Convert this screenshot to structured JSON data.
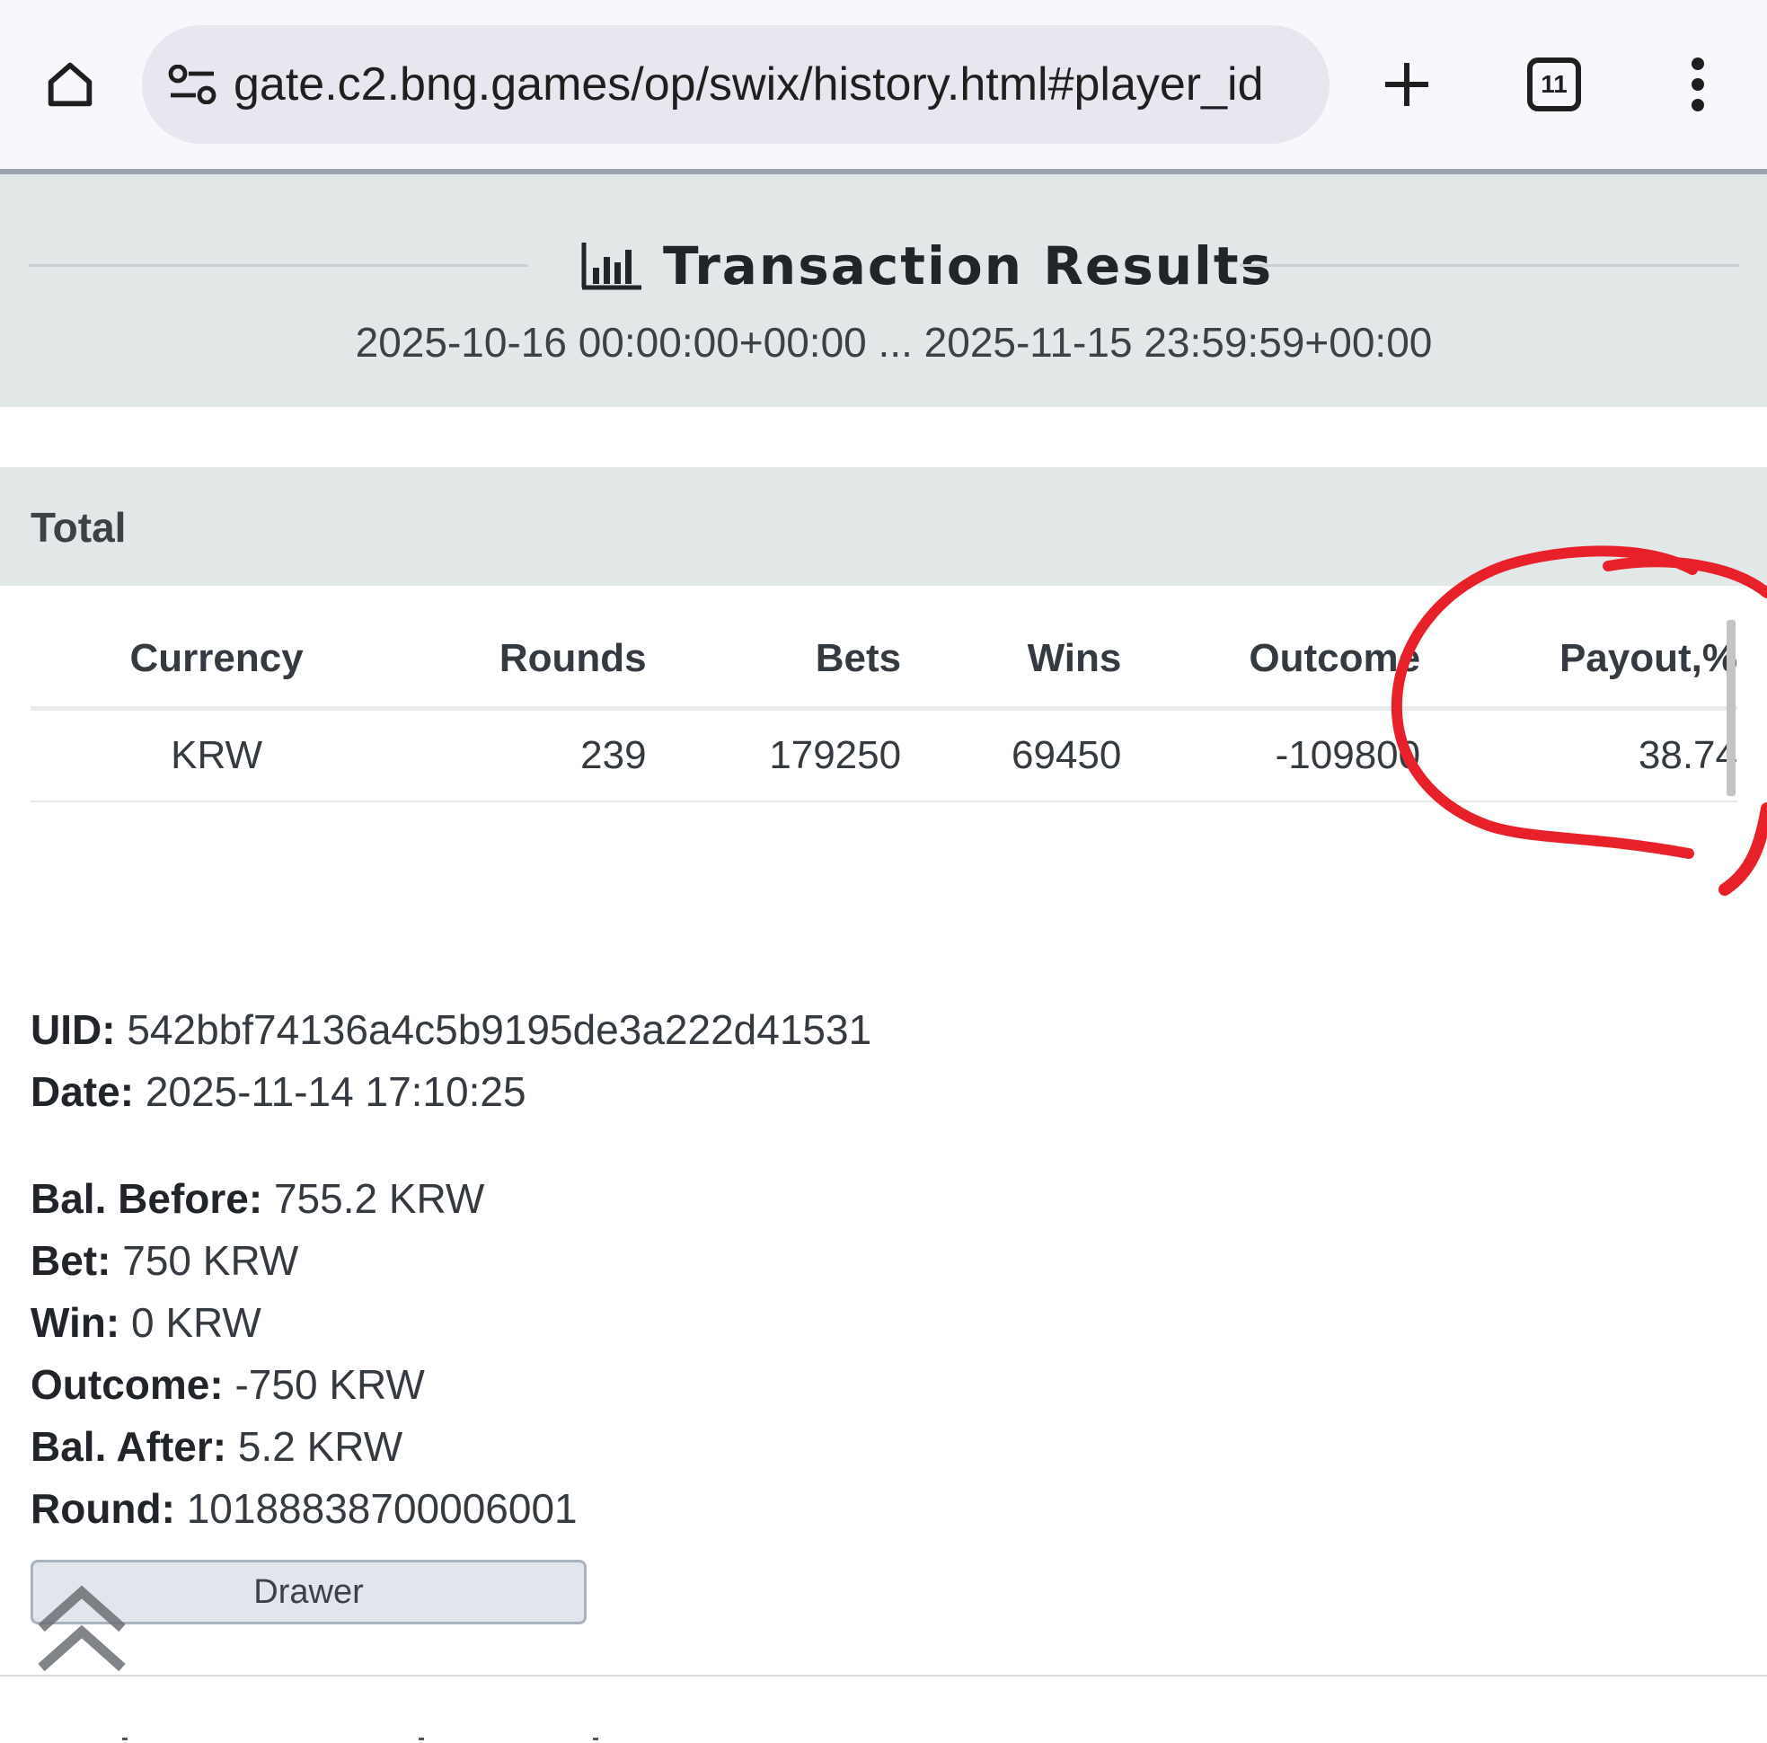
{
  "browser": {
    "url": "gate.c2.bng.games/op/swix/history.html#player_id",
    "tab_count": "11",
    "icons": {
      "home": "home-icon",
      "site_settings": "tune-icon",
      "new_tab": "plus-icon",
      "tabs": "tab-switcher-icon",
      "menu": "more-vert-icon"
    }
  },
  "header": {
    "icon": "bar-chart-icon",
    "title": "Transaction Results",
    "date_range": "2025-10-16 00:00:00+00:00 ... 2025-11-15 23:59:59+00:00"
  },
  "total": {
    "heading": "Total",
    "columns": [
      "Currency",
      "Rounds",
      "Bets",
      "Wins",
      "Outcome",
      "Payout,%"
    ],
    "rows": [
      [
        "KRW",
        "239",
        "179250",
        "69450",
        "-109800",
        "38.74"
      ]
    ]
  },
  "transaction": {
    "uid_label": "UID:",
    "uid_value": "542bbf74136a4c5b9195de3a222d41531",
    "date_label": "Date:",
    "date_value": "2025-11-14 17:10:25",
    "bal_before_label": "Bal. Before:",
    "bal_before_value": "755.2 KRW",
    "bet_label": "Bet:",
    "bet_value": "750 KRW",
    "win_label": "Win:",
    "win_value": "0 KRW",
    "outcome_label": "Outcome:",
    "outcome_value": "-750 KRW",
    "bal_after_label": "Bal. After:",
    "bal_after_value": "5.2 KRW",
    "round_label": "Round:",
    "round_value": "10188838700006001"
  },
  "drawer_button": {
    "label": "Drawer"
  },
  "colors": {
    "header_band": "#e2e7e8",
    "annotation_red": "#e8202a",
    "text": "#343a40"
  }
}
